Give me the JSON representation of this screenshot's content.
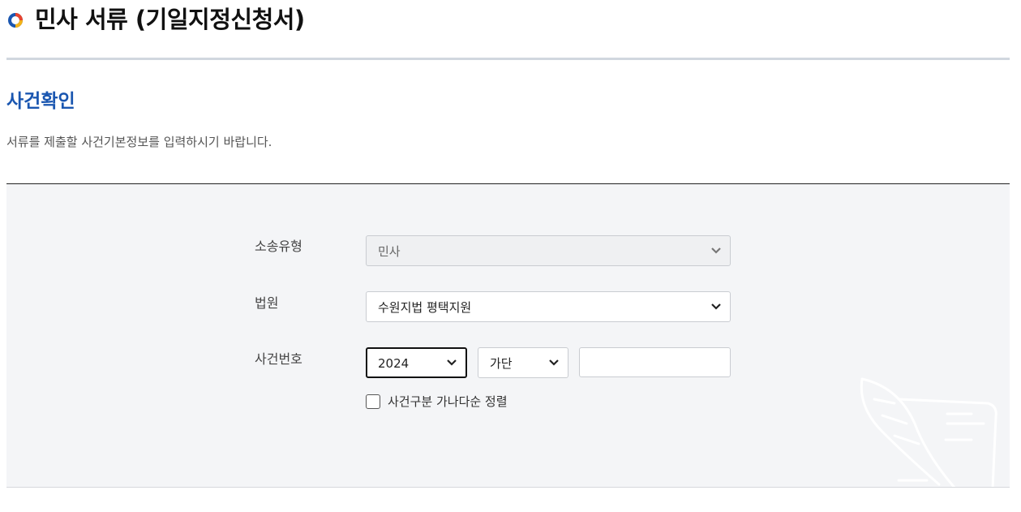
{
  "header": {
    "title": "민사 서류 (기일지정신청서)",
    "logo_icon": "ring-logo-icon"
  },
  "section": {
    "title": "사건확인",
    "description": "서류를 제출할 사건기본정보를 입력하시기 바랍니다."
  },
  "form": {
    "case_type": {
      "label": "소송유형",
      "value": "민사",
      "disabled": true
    },
    "court": {
      "label": "법원",
      "value": "수원지법 평택지원"
    },
    "case_number": {
      "label": "사건번호",
      "year": "2024",
      "category": "가단",
      "number_value": "",
      "number_placeholder": ""
    },
    "sort_option": {
      "label": "사건구분 가나다순 정렬",
      "checked": false
    }
  },
  "colors": {
    "accent_blue": "#1a56b0",
    "panel_bg": "#f4f5f7"
  },
  "icons": [
    "chevron-down-icon",
    "feather-document-icon"
  ]
}
